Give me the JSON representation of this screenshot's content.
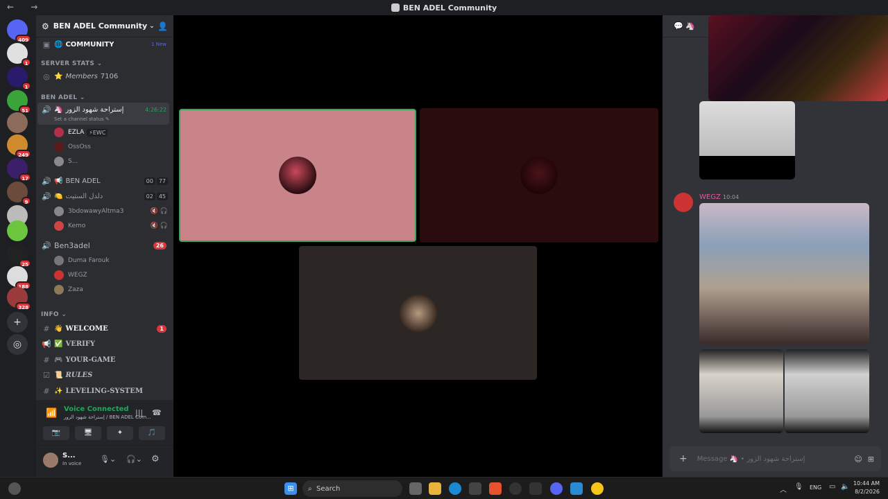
{
  "window": {
    "title": "BEN ADEL Community",
    "nav": "← →"
  },
  "rail": {
    "servers": [
      {
        "name": "discord-home",
        "badge": "409",
        "color": "#5865f2"
      },
      {
        "name": "server-2",
        "badge": "1",
        "color": "#e0e0e0"
      },
      {
        "name": "server-ea",
        "badge": "1",
        "color": "#2a1a6b"
      },
      {
        "name": "server-w",
        "badge": "51",
        "color": "#3aa33a"
      },
      {
        "name": "server-5",
        "badge": "",
        "color": "#8c6b5b"
      },
      {
        "name": "server-6",
        "badge": "249",
        "color": "#d08a2e"
      },
      {
        "name": "server-ea2",
        "badge": "17",
        "color": "#3c1f6b"
      },
      {
        "name": "server-8",
        "badge": "9",
        "color": "#6b4b3b"
      },
      {
        "name": "server-9",
        "badge": "",
        "color": "#bbb"
      },
      {
        "name": "server-10",
        "badge": "",
        "color": "#6cc63d"
      },
      {
        "name": "server-tn",
        "badge": "25",
        "color": "#222"
      },
      {
        "name": "server-12",
        "badge": "188",
        "color": "#ddd"
      },
      {
        "name": "server-13",
        "badge": "328",
        "color": "#9b3a3a"
      }
    ]
  },
  "sidebar": {
    "server_name": "BEN ADEL Community",
    "top_channel": {
      "emoji": "🌐",
      "name": "COMMUNITY",
      "new": "1 New"
    },
    "cat_stats": "SERVER STATS",
    "members_label": "Members",
    "members_value": "7106",
    "cat_benadel": "BEN ADEL",
    "voice_active": {
      "name": "إستراحة شهود الزور",
      "time": "4:26:22",
      "status": "Set a channel status"
    },
    "voice_users_1": [
      {
        "name": "EZLA",
        "tag": "⚡EWC",
        "color": "#b3304a"
      },
      {
        "name": "OssOss",
        "color": "#5a1a1a"
      },
      {
        "name": "S...",
        "color": "#8a8a8a"
      }
    ],
    "voice_ben": {
      "name": "BEN ADEL",
      "c1": "00",
      "c2": "77"
    },
    "voice_dl": {
      "name": "دلدل الستيت",
      "c1": "02",
      "c2": "45"
    },
    "voice_users_2": [
      {
        "name": "3bdowawyAltma3",
        "color": "#888"
      },
      {
        "name": "Kemo",
        "color": "#c44"
      }
    ],
    "voice_ben3": {
      "name": "Ben3adel",
      "badge": "26"
    },
    "voice_users_3": [
      {
        "name": "Duma Farouk",
        "color": "#777"
      },
      {
        "name": "WEGZ",
        "color": "#c33"
      },
      {
        "name": "Zaza",
        "color": "#8a7a5a"
      }
    ],
    "cat_info": "INFO",
    "info_channels": [
      {
        "icon": "#",
        "emoji": "👋",
        "name": "WELCOME",
        "badge": "1",
        "bold": true
      },
      {
        "icon": "📢",
        "emoji": "✅",
        "name": "VERIFY",
        "bold": false
      },
      {
        "icon": "#",
        "emoji": "🎮",
        "name": "YOUR-GAME",
        "bold": false
      },
      {
        "icon": "☑",
        "emoji": "📜",
        "name": "RULES",
        "bold": false,
        "italic": true
      },
      {
        "icon": "#",
        "emoji": "✨",
        "name": "LEVELING-SYSTEM",
        "bold": false
      }
    ]
  },
  "voice_panel": {
    "status": "Voice Connected",
    "channel": "إستراحة شهود الزور / BEN ADEL Com...",
    "buttons": [
      "📷",
      "🖥",
      "✦",
      "🎵"
    ]
  },
  "user_panel": {
    "name": "S...",
    "status": "In voice"
  },
  "chat": {
    "author": "WEGZ",
    "time": "10:04",
    "input_placeholder": "Message 🦄 • إستراحة شهود الزور"
  },
  "taskbar": {
    "search": "Search",
    "lang": "ENG",
    "time": "10:44 AM",
    "date": "8/2/2026"
  }
}
